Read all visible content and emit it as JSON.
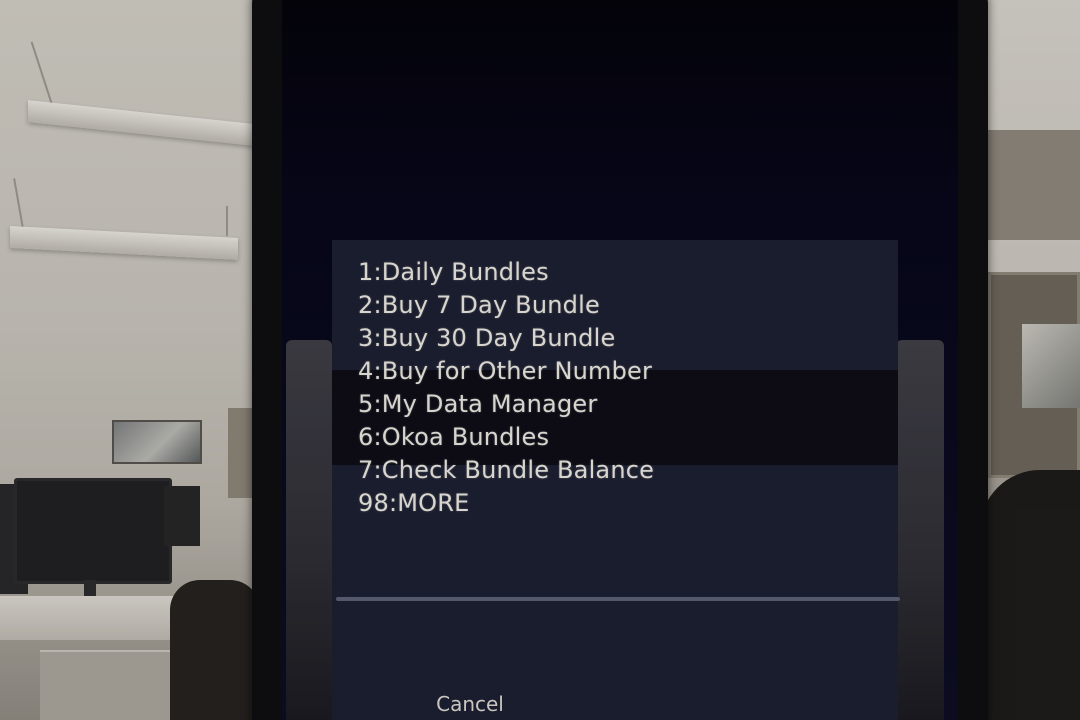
{
  "ussd": {
    "options": [
      "1:Daily Bundles",
      "2:Buy 7 Day Bundle",
      "3:Buy 30 Day Bundle",
      "4:Buy for Other Number",
      "5:My Data Manager",
      "6:Okoa Bundles",
      "7:Check Bundle Balance",
      "98:MORE"
    ],
    "input_value": "",
    "cancel_label": "Cancel"
  },
  "colors": {
    "dialog_background": "#1b1f30",
    "text": "#e8e6df",
    "phone_body": "#0c0c10"
  }
}
